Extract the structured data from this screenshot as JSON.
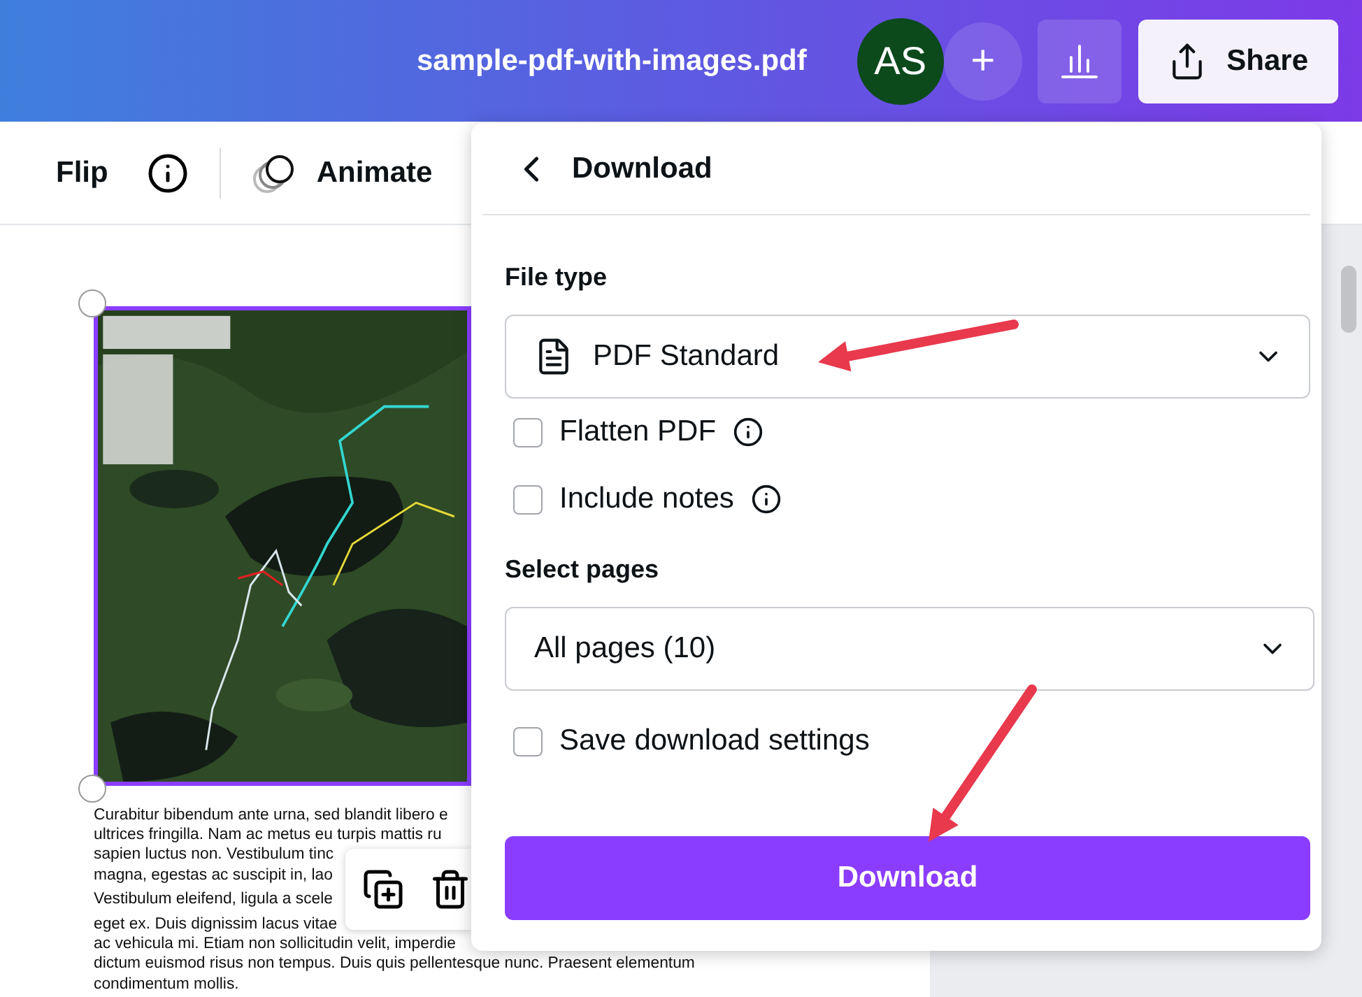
{
  "header": {
    "title": "sample-pdf-with-images.pdf",
    "avatar": "AS",
    "add": "+",
    "share": "Share"
  },
  "toolbar": {
    "flip": "Flip",
    "animate": "Animate"
  },
  "page": {
    "image": {
      "kind": "picture",
      "selected": true
    },
    "paragraphs": [
      [
        "Curabitur bibendum ante urna, sed blandit libero e",
        "ultrices fringilla. Nam ac metus eu turpis mattis ru",
        "sapien luctus non. Vestibulum tinc",
        "magna, egestas ac suscipit in, lao"
      ],
      [
        "Vestibulum eleifend, ligula a scele"
      ],
      [
        "eget ex. Duis dignissim lacus vitae",
        "ac vehicula mi. Etiam non sollicitudin velit, imperdie",
        "dictum euismod risus non tempus. Duis quis pellentesque nunc. Praesent elementum",
        "condimentum mollis."
      ]
    ]
  },
  "download_panel": {
    "title": "Download",
    "file_type_label": "File type",
    "file_type": "PDF Standard",
    "options": [
      {
        "label": "Flatten PDF",
        "checked": false,
        "info": true
      },
      {
        "label": "Include notes",
        "checked": false,
        "info": true
      }
    ],
    "select_pages_label": "Select pages",
    "pages": "All pages (10)",
    "save_settings": {
      "label": "Save download settings",
      "checked": false
    },
    "button": "Download"
  }
}
